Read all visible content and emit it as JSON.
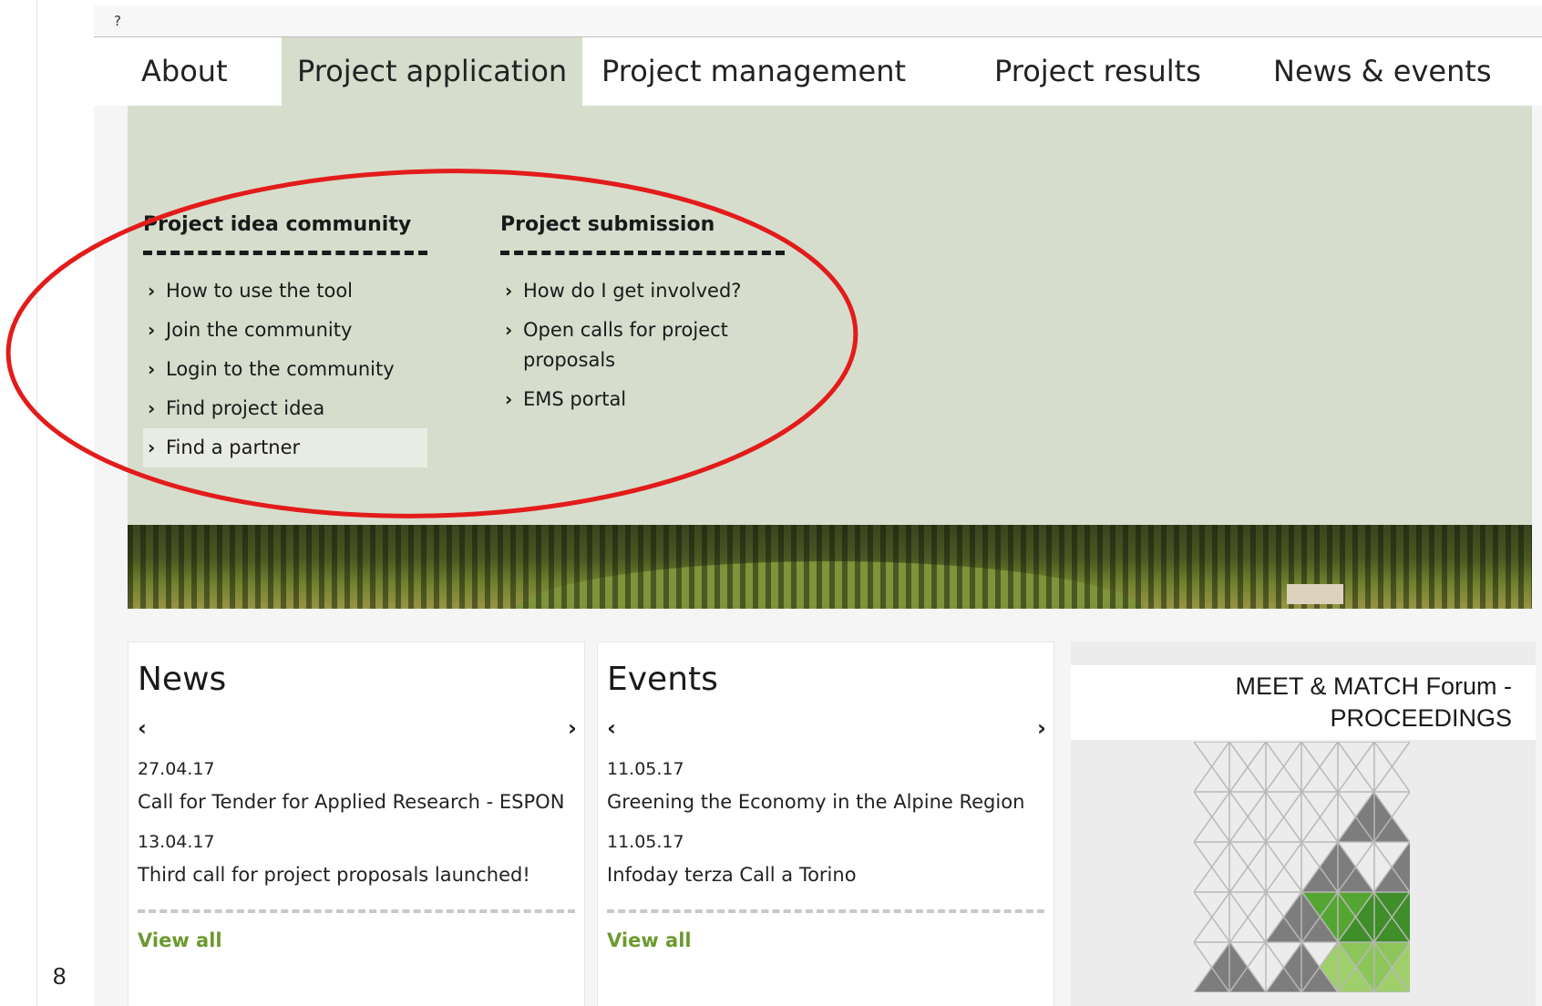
{
  "page_number": "8",
  "topbar": {
    "help_glyph": "?"
  },
  "nav": {
    "items": [
      {
        "label": "About"
      },
      {
        "label": "Project application",
        "active": true
      },
      {
        "label": "Project management"
      },
      {
        "label": "Project results"
      },
      {
        "label": "News & events"
      }
    ]
  },
  "dropdown": {
    "columns": [
      {
        "heading": "Project idea community",
        "links": [
          "How to use the tool",
          "Join the community",
          "Login to the community",
          "Find project idea",
          "Find a partner"
        ]
      },
      {
        "heading": "Project submission",
        "links": [
          "How do I get involved?",
          "Open calls for project",
          "proposals",
          "EMS portal"
        ]
      }
    ]
  },
  "news": {
    "title": "News",
    "prev": "‹",
    "next": "›",
    "entries": [
      {
        "date": "27.04.17",
        "title": "Call for Tender for Applied Research - ESPON"
      },
      {
        "date": "13.04.17",
        "title": "Third call for project proposals launched!"
      }
    ],
    "view_all": "View all"
  },
  "events": {
    "title": "Events",
    "prev": "‹",
    "next": "›",
    "entries": [
      {
        "date": "11.05.17",
        "title": "Greening the Economy in the Alpine Region"
      },
      {
        "date": "11.05.17",
        "title": "Infoday terza Call a Torino"
      }
    ],
    "view_all": "View all"
  },
  "promo": {
    "title_line1": "MEET & MATCH Forum -",
    "title_line2": "PROCEEDINGS"
  },
  "colors": {
    "menu_bg": "#d6ddcc",
    "link_green": "#6c9a2e",
    "annotation_red": "#e31b1b"
  },
  "icons": [
    "chevron-right-icon",
    "chevron-left-icon",
    "help-icon"
  ]
}
